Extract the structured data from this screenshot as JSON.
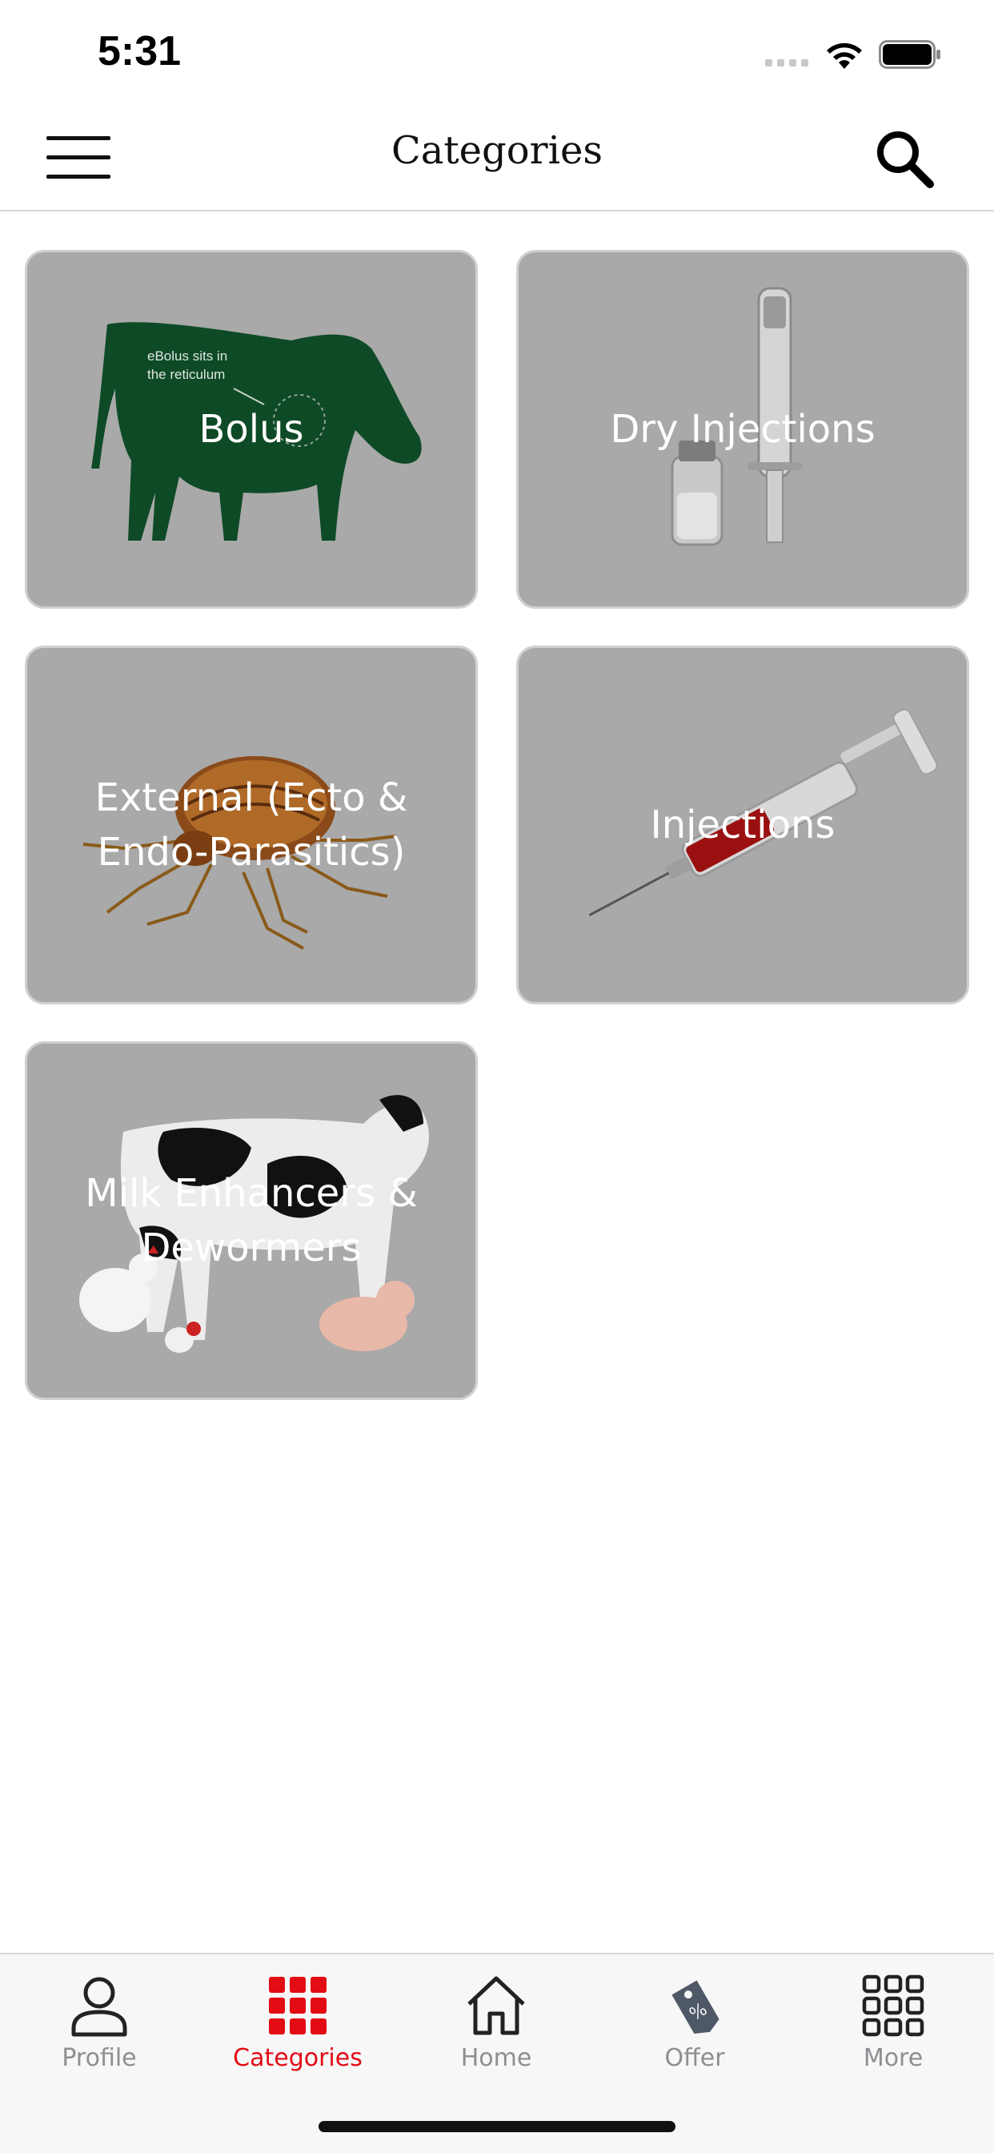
{
  "status_bar": {
    "time": "5:31"
  },
  "header": {
    "title": "Categories"
  },
  "categories": [
    {
      "label": "Bolus",
      "image_text": "eBolus sits in the reticulum",
      "image_text_line1": "eBolus sits in",
      "image_text_line2": "the reticulum"
    },
    {
      "label": "Dry Injections"
    },
    {
      "label": "External (Ecto & Endo-Parasitics)"
    },
    {
      "label": "Injections"
    },
    {
      "label": "Milk Enhancers & Dewormers"
    }
  ],
  "tab_bar": {
    "tabs": [
      {
        "label": "Profile",
        "icon": "person-icon",
        "active": false
      },
      {
        "label": "Categories",
        "icon": "grid-icon",
        "active": true
      },
      {
        "label": "Home",
        "icon": "home-icon",
        "active": false
      },
      {
        "label": "Offer",
        "icon": "tag-icon",
        "active": false
      },
      {
        "label": "More",
        "icon": "more-grid-icon",
        "active": false
      }
    ]
  },
  "colors": {
    "accent": "#e30b14",
    "card_overlay": "#a9a9a9",
    "tab_inactive": "#8e8e93"
  }
}
